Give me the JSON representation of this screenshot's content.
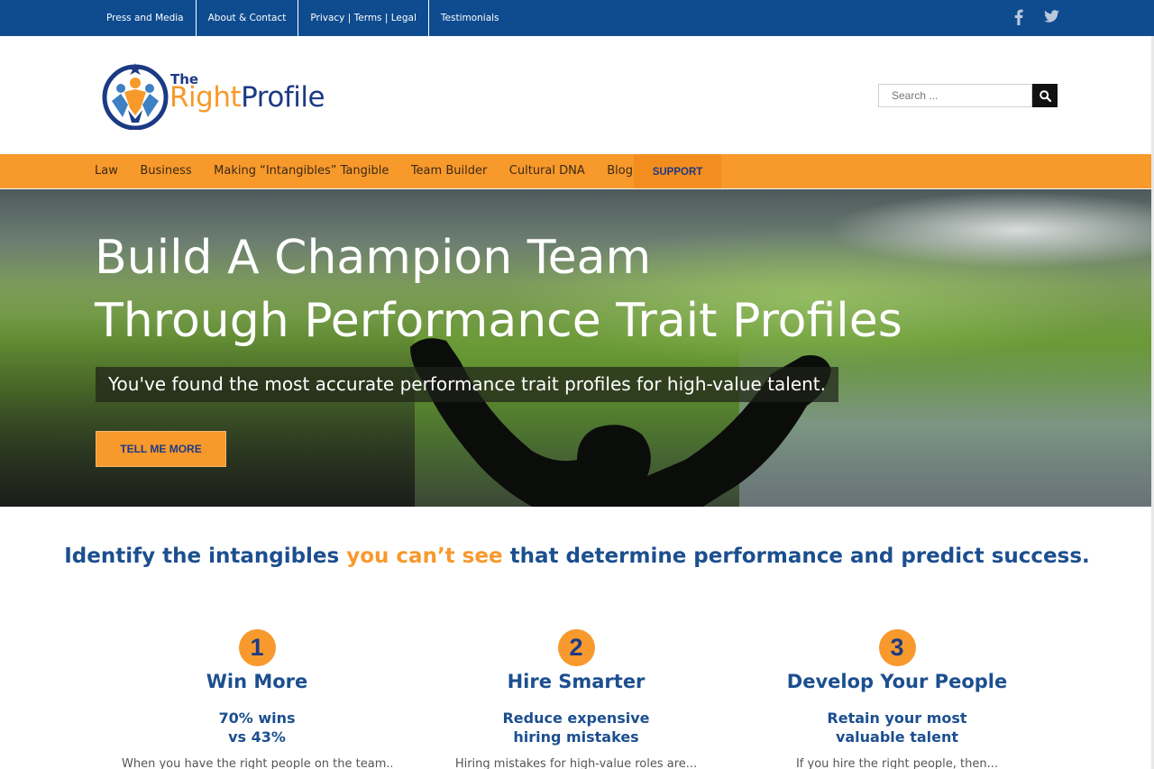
{
  "topbar": {
    "links": [
      "Press and Media",
      "About & Contact",
      "Privacy | Terms | Legal",
      "Testimonials"
    ],
    "social": [
      {
        "icon": "facebook-icon",
        "glyph": "f"
      },
      {
        "icon": "twitter-icon",
        "glyph": "t"
      }
    ]
  },
  "logo": {
    "the": "The",
    "right": "Right",
    "profile": "Profile"
  },
  "search": {
    "placeholder": "Search ..."
  },
  "nav": {
    "items": [
      "Law",
      "Business",
      "Making “Intangibles” Tangible",
      "Team Builder",
      "Cultural DNA",
      "Blog"
    ],
    "support": "SUPPORT"
  },
  "hero": {
    "line1": "Build A Champion Team",
    "line2": "Through Performance Trait Profiles",
    "subtitle": "You've found the most accurate performance trait profiles for high-value talent.",
    "cta": "TELL ME MORE"
  },
  "tagline": {
    "part1": "Identify the intangibles ",
    "accent": "you can’t see",
    "part2": " that determine performance and predict success."
  },
  "features": [
    {
      "number": "1",
      "title": "Win More",
      "stat_line1": "70% wins",
      "stat_line2": "vs 43%",
      "body": "When you have the right people on the team..."
    },
    {
      "number": "2",
      "title": "Hire Smarter",
      "stat_line1": "Reduce expensive",
      "stat_line2": "hiring mistakes",
      "body": "Hiring mistakes for high-value roles are..."
    },
    {
      "number": "3",
      "title": "Develop Your People",
      "stat_line1": "Retain your most",
      "stat_line2": "valuable talent",
      "body": "If you hire the right people, then..."
    }
  ],
  "colors": {
    "brand_blue": "#0e4b8f",
    "brand_orange": "#f8992c",
    "heading_blue": "#1c4f8f"
  }
}
